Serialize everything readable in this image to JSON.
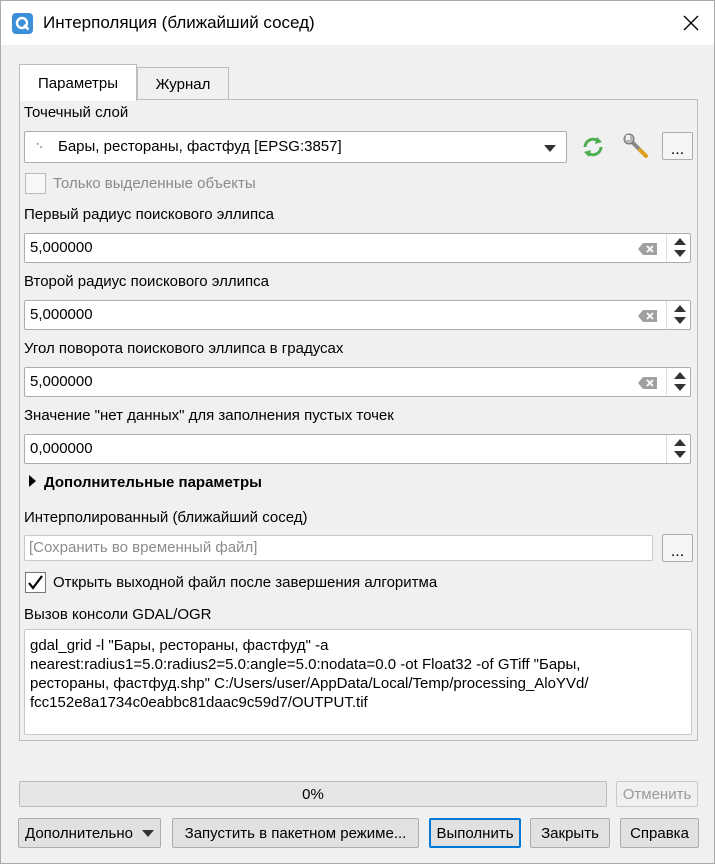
{
  "window": {
    "title": "Интерполяция (ближайший сосед)"
  },
  "tabs": [
    {
      "label": "Параметры",
      "active": true
    },
    {
      "label": "Журнал",
      "active": false
    }
  ],
  "params": {
    "point_layer_label": "Точечный слой",
    "point_layer_value": "Бары, рестораны, фастфуд [EPSG:3857]",
    "selected_only_label": "Только выделенные объекты",
    "radius1_label": "Первый радиус поискового эллипса",
    "radius1_value": "5,000000",
    "radius2_label": "Второй радиус поискового эллипса",
    "radius2_value": "5,000000",
    "angle_label": "Угол поворота поискового эллипса в градусах",
    "angle_value": "5,000000",
    "nodata_label": "Значение \"нет данных\" для заполнения пустых точек",
    "nodata_value": "0,000000",
    "advanced_label": "Дополнительные параметры",
    "output_label": "Интерполированный (ближайший сосед)",
    "output_placeholder": "[Сохранить во временный файл]",
    "open_output_label": "Открыть выходной файл после завершения алгоритма",
    "open_output_checked": true,
    "console_label": "Вызов консоли GDAL/OGR",
    "console_text": "gdal_grid -l \"Бары, рестораны, фастфуд\" -a\nnearest:radius1=5.0:radius2=5.0:angle=5.0:nodata=0.0 -ot Float32 -of GTiff \"Бары,\nрестораны, фастфуд.shp\" C:/Users/user/AppData/Local/Temp/processing_AloYVd/\nfcc152e8a1734c0eabbc81daac9c59d7/OUTPUT.tif"
  },
  "progress": {
    "text": "0%",
    "value": 0
  },
  "buttons": {
    "cancel": "Отменить",
    "advanced": "Дополнительно",
    "batch": "Запустить в пакетном режиме...",
    "run": "Выполнить",
    "close": "Закрыть",
    "help": "Справка"
  },
  "colors": {
    "accent": "#0078d7",
    "app_icon": "#3b8ed8",
    "refresh_icon": "#4caf50"
  }
}
